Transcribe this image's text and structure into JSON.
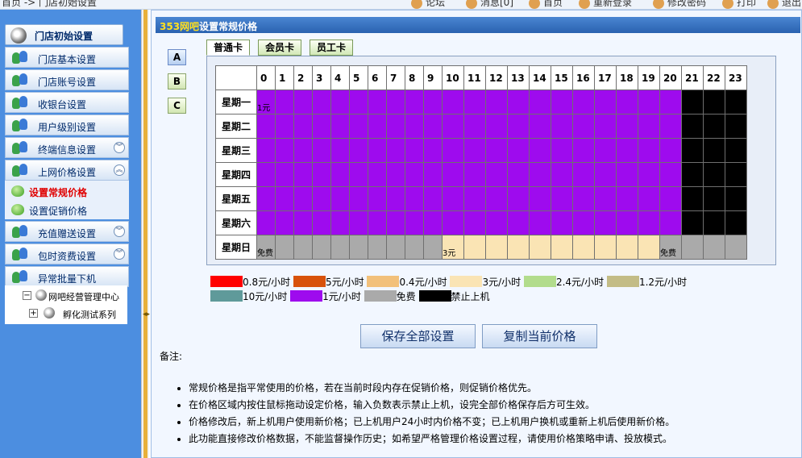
{
  "topbar": {
    "breadcrumb": "首页 -> 门店初始设置",
    "toolbar": [
      "论坛",
      "消息[0]",
      "首页",
      "重新登录",
      "修改密码",
      "打印",
      "退出"
    ]
  },
  "sidebar": {
    "header": "门店初始设置",
    "items": [
      {
        "label": "门店基本设置"
      },
      {
        "label": "门店账号设置"
      },
      {
        "label": "收银台设置"
      },
      {
        "label": "用户级别设置"
      },
      {
        "label": "终端信息设置",
        "chevron": "expand"
      },
      {
        "label": "上网价格设置",
        "chevron": "collapse"
      },
      {
        "label": "充值赠送设置",
        "chevron": "expand"
      },
      {
        "label": "包时资费设置",
        "chevron": "expand"
      },
      {
        "label": "异常批量下机"
      }
    ],
    "sub_items": [
      {
        "label": "设置常规价格",
        "active": true
      },
      {
        "label": "设置促销价格",
        "active": false
      }
    ],
    "tree": [
      {
        "toggle": "−",
        "label": "网吧经营管理中心"
      },
      {
        "toggle": "+",
        "label": "孵化测试系列"
      }
    ]
  },
  "main": {
    "title_prefix": "353网吧",
    "title_rest": "设置常规价格",
    "abc_buttons": [
      "A",
      "B",
      "C"
    ],
    "tabs": [
      "普通卡",
      "会员卡",
      "员工卡"
    ],
    "hours": [
      "0",
      "1",
      "2",
      "3",
      "4",
      "5",
      "6",
      "7",
      "8",
      "9",
      "10",
      "11",
      "12",
      "13",
      "14",
      "15",
      "16",
      "17",
      "18",
      "19",
      "20",
      "21",
      "22",
      "23"
    ],
    "days": [
      "星期一",
      "星期二",
      "星期三",
      "星期四",
      "星期五",
      "星期六",
      "星期日"
    ],
    "price_grid": [
      {
        "segments": [
          {
            "from": 0,
            "to": 20,
            "price": "1元",
            "label": "1元"
          },
          {
            "from": 21,
            "to": 23,
            "price": "禁止上机",
            "label": ""
          }
        ]
      },
      {
        "segments": [
          {
            "from": 0,
            "to": 20,
            "price": "1元",
            "label": ""
          },
          {
            "from": 21,
            "to": 23,
            "price": "禁止上机",
            "label": ""
          }
        ]
      },
      {
        "segments": [
          {
            "from": 0,
            "to": 20,
            "price": "1元",
            "label": ""
          },
          {
            "from": 21,
            "to": 23,
            "price": "禁止上机",
            "label": ""
          }
        ]
      },
      {
        "segments": [
          {
            "from": 0,
            "to": 20,
            "price": "1元",
            "label": ""
          },
          {
            "from": 21,
            "to": 23,
            "price": "禁止上机",
            "label": ""
          }
        ]
      },
      {
        "segments": [
          {
            "from": 0,
            "to": 20,
            "price": "1元",
            "label": ""
          },
          {
            "from": 21,
            "to": 23,
            "price": "禁止上机",
            "label": ""
          }
        ]
      },
      {
        "segments": [
          {
            "from": 0,
            "to": 20,
            "price": "1元",
            "label": ""
          },
          {
            "from": 21,
            "to": 23,
            "price": "禁止上机",
            "label": ""
          }
        ]
      },
      {
        "segments": [
          {
            "from": 0,
            "to": 9,
            "price": "免费",
            "label": "免费"
          },
          {
            "from": 10,
            "to": 19,
            "price": "3元",
            "label": "3元"
          },
          {
            "from": 20,
            "to": 23,
            "price": "免费",
            "label": "免费"
          }
        ]
      }
    ],
    "legend": [
      {
        "label": "0.8元/小时",
        "color": "#ff0000"
      },
      {
        "label": "5元/小时",
        "color": "#d8520a"
      },
      {
        "label": "0.4元/小时",
        "color": "#f2c07a"
      },
      {
        "label": "3元/小时",
        "color": "#fae4b4"
      },
      {
        "label": "2.4元/小时",
        "color": "#b2dc8c"
      },
      {
        "label": "1.2元/小时",
        "color": "#c3bc86"
      },
      {
        "label": "10元/小时",
        "color": "#5f9a9a"
      },
      {
        "label": "1元/小时",
        "color": "#9e0bee"
      },
      {
        "label": "免费",
        "color": "#aaaaaa"
      },
      {
        "label": "禁止上机",
        "color": "#000000"
      }
    ],
    "price_colors": {
      "1元": "#9e0bee",
      "禁止上机": "#000000",
      "免费": "#aaaaaa",
      "3元": "#fae4b4"
    },
    "buttons": {
      "save": "保存全部设置",
      "copy": "复制当前价格"
    },
    "notes_label": "备注:",
    "notes": [
      "常规价格是指平常使用的价格，若在当前时段内存在促销价格，则促销价格优先。",
      "在价格区域内按住鼠标拖动设定价格，输入负数表示禁止上机，设完全部价格保存后方可生效。",
      "价格修改后，新上机用户使用新价格；已上机用户24小时内价格不变；已上机用户换机或重新上机后使用新价格。",
      "此功能直接修改价格数据，不能监督操作历史；如希望严格管理价格设置过程，请使用价格策略申请、投放模式。"
    ]
  }
}
